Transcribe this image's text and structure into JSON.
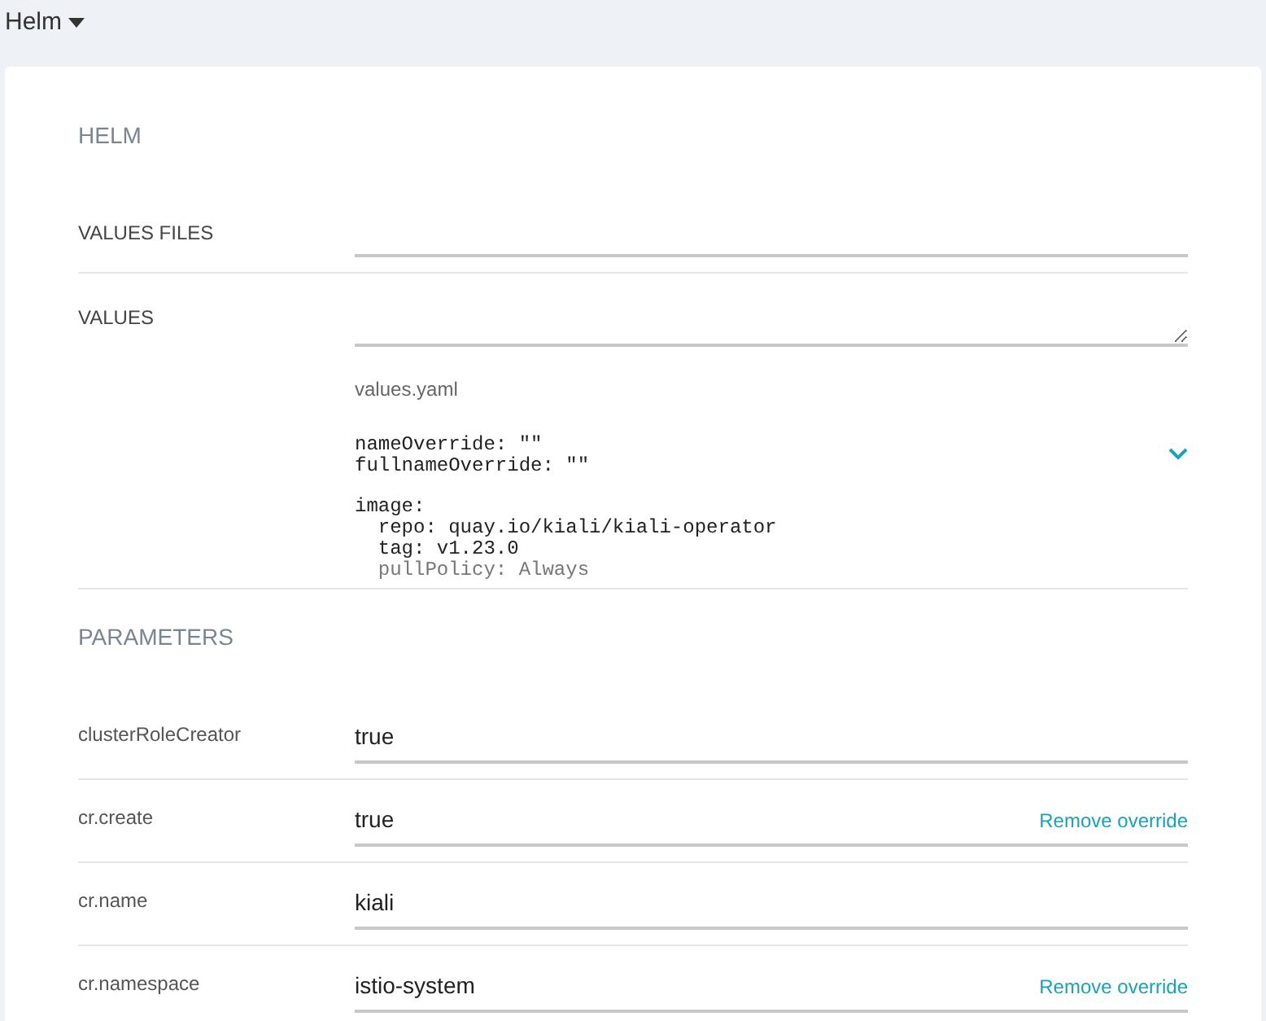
{
  "header": {
    "title": "Helm"
  },
  "helm": {
    "title": "HELM",
    "values_files": {
      "label": "VALUES FILES"
    },
    "values": {
      "label": "VALUES",
      "file_name": "values.yaml",
      "blocks": [
        [
          "nameOverride: \"\"",
          "fullnameOverride: \"\""
        ],
        [
          "image:",
          "  repo: quay.io/kiali/kiali-operator",
          "  tag: v1.23.0",
          "  pullPolicy: Always"
        ]
      ]
    }
  },
  "parameters": {
    "title": "PARAMETERS",
    "rows": [
      {
        "name": "clusterRoleCreator",
        "value": "true"
      },
      {
        "name": "cr.create",
        "value": "true",
        "action": "Remove override"
      },
      {
        "name": "cr.name",
        "value": "kiali"
      },
      {
        "name": "cr.namespace",
        "value": "istio-system",
        "action": "Remove override"
      }
    ]
  }
}
